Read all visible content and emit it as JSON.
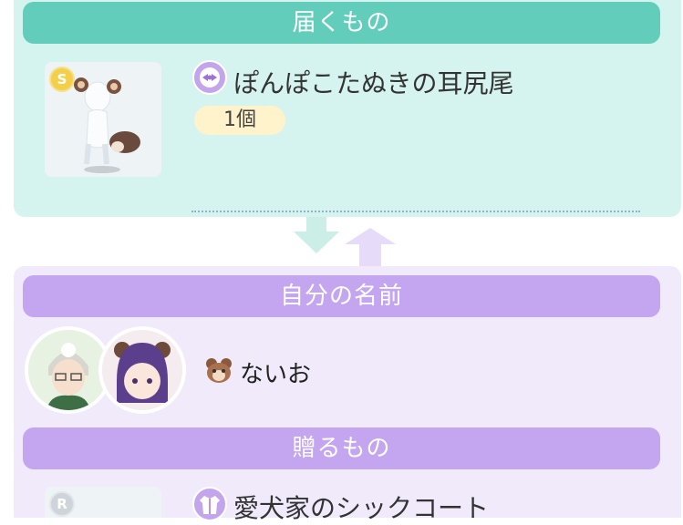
{
  "receive": {
    "header": "届くもの",
    "item_name": "ぽんぽこたぬきの耳尻尾",
    "quantity": "1個",
    "rarity": "S",
    "icon": "bow-hair-accessory-icon"
  },
  "sender": {
    "header": "自分の名前",
    "name": "ないお",
    "icon": "tanuki-emblem-icon"
  },
  "send": {
    "header": "贈るもの",
    "item_name": "愛犬家のシックコート",
    "rarity": "R",
    "icon": "coat-icon"
  },
  "colors": {
    "receive_bar": "#63cdbc",
    "receive_panel": "#d6f4ef",
    "send_bar": "#c4a6f0",
    "send_panel": "#f0eafb",
    "quantity_pill": "#fff3cc"
  }
}
